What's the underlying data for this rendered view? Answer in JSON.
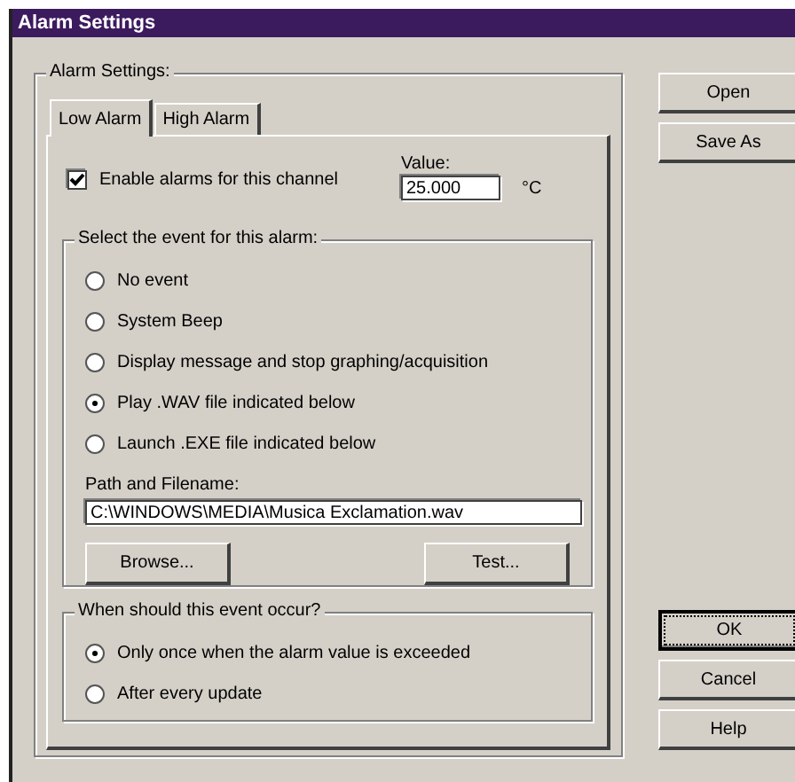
{
  "window": {
    "title": "Alarm Settings"
  },
  "group": {
    "label": "Alarm Settings:"
  },
  "tabs": [
    {
      "label": "Low Alarm",
      "selected": true
    },
    {
      "label": "High Alarm",
      "selected": false
    }
  ],
  "enable": {
    "label": "Enable alarms for this channel",
    "checked": true
  },
  "value": {
    "label": "Value:",
    "value": "25.000",
    "unit": "°C"
  },
  "event_group": {
    "label": "Select the event for this alarm:",
    "options": [
      {
        "label": "No event",
        "selected": false
      },
      {
        "label": "System Beep",
        "selected": false
      },
      {
        "label": "Display message and stop graphing/acquisition",
        "selected": false
      },
      {
        "label": "Play .WAV file indicated below",
        "selected": true
      },
      {
        "label": "Launch .EXE file indicated below",
        "selected": false
      }
    ]
  },
  "path": {
    "label": "Path and Filename:",
    "value": "C:\\WINDOWS\\MEDIA\\Musica Exclamation.wav"
  },
  "path_buttons": [
    "Browse...",
    "Test..."
  ],
  "occur_group": {
    "label": "When should this event occur?",
    "options": [
      {
        "label": "Only once when the alarm value is exceeded",
        "selected": true
      },
      {
        "label": "After every update",
        "selected": false
      }
    ]
  },
  "side_buttons": [
    {
      "label": "Open",
      "default": false
    },
    {
      "label": "Save As",
      "default": false
    }
  ],
  "bottom_buttons": [
    {
      "label": "OK",
      "default": true
    },
    {
      "label": "Cancel",
      "default": false
    },
    {
      "label": "Help",
      "default": false
    }
  ]
}
